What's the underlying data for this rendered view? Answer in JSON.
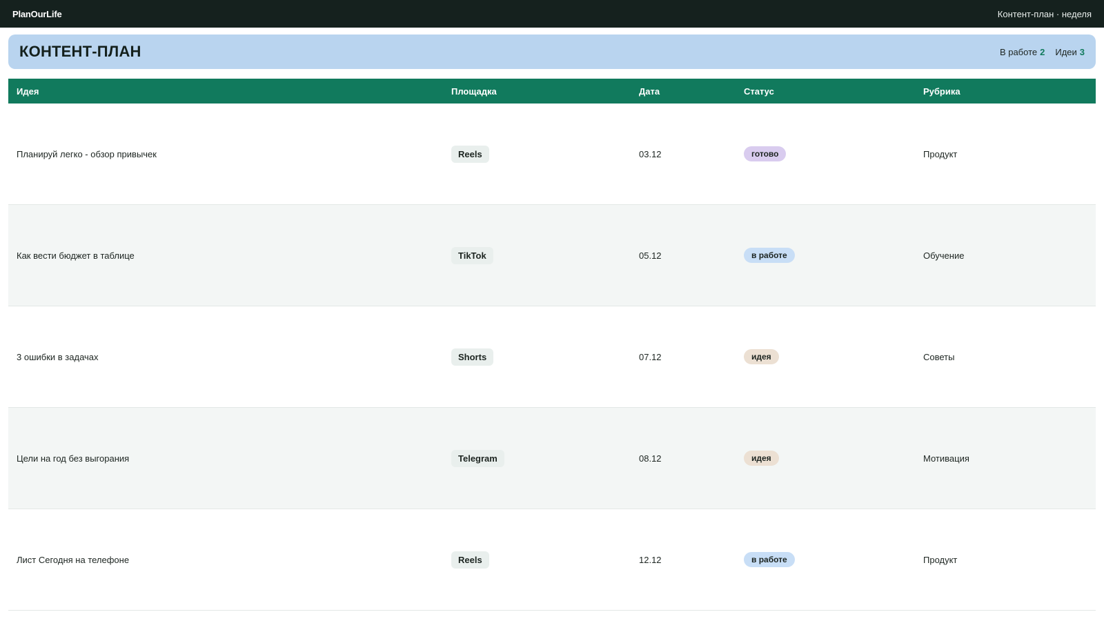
{
  "topbar": {
    "brand": "PlanOurLife",
    "right_label": "Контент-план · неделя"
  },
  "header": {
    "title": "КОНТЕНТ-ПЛАН",
    "stats": [
      {
        "label": "В работе",
        "value": "2"
      },
      {
        "label": "Идеи",
        "value": "3"
      }
    ]
  },
  "table": {
    "columns": [
      "Идея",
      "Площадка",
      "Дата",
      "Статус",
      "Рубрика"
    ],
    "rows": [
      {
        "idea": "Планируй легко - обзор привычек",
        "platform": "Reels",
        "date": "03.12",
        "status": "готово",
        "category": "Продукт"
      },
      {
        "idea": "Как вести бюджет в таблице",
        "platform": "TikTok",
        "date": "05.12",
        "status": "в работе",
        "category": "Обучение"
      },
      {
        "idea": "3 ошибки в задачах",
        "platform": "Shorts",
        "date": "07.12",
        "status": "идея",
        "category": "Советы"
      },
      {
        "idea": "Цели на год без выгорания",
        "platform": "Telegram",
        "date": "08.12",
        "status": "идея",
        "category": "Мотивация"
      },
      {
        "idea": "Лист Сегодня на телефоне",
        "platform": "Reels",
        "date": "12.12",
        "status": "в работе",
        "category": "Продукт"
      }
    ]
  },
  "colors": {
    "topbar_bg": "#15211e",
    "header_bg": "#b9d4ef",
    "table_header_bg": "#117a5d",
    "accent_green": "#127b5d",
    "status_ready": "#d9ccef",
    "status_in_progress": "#c8def6",
    "status_idea": "#ece0d3"
  }
}
